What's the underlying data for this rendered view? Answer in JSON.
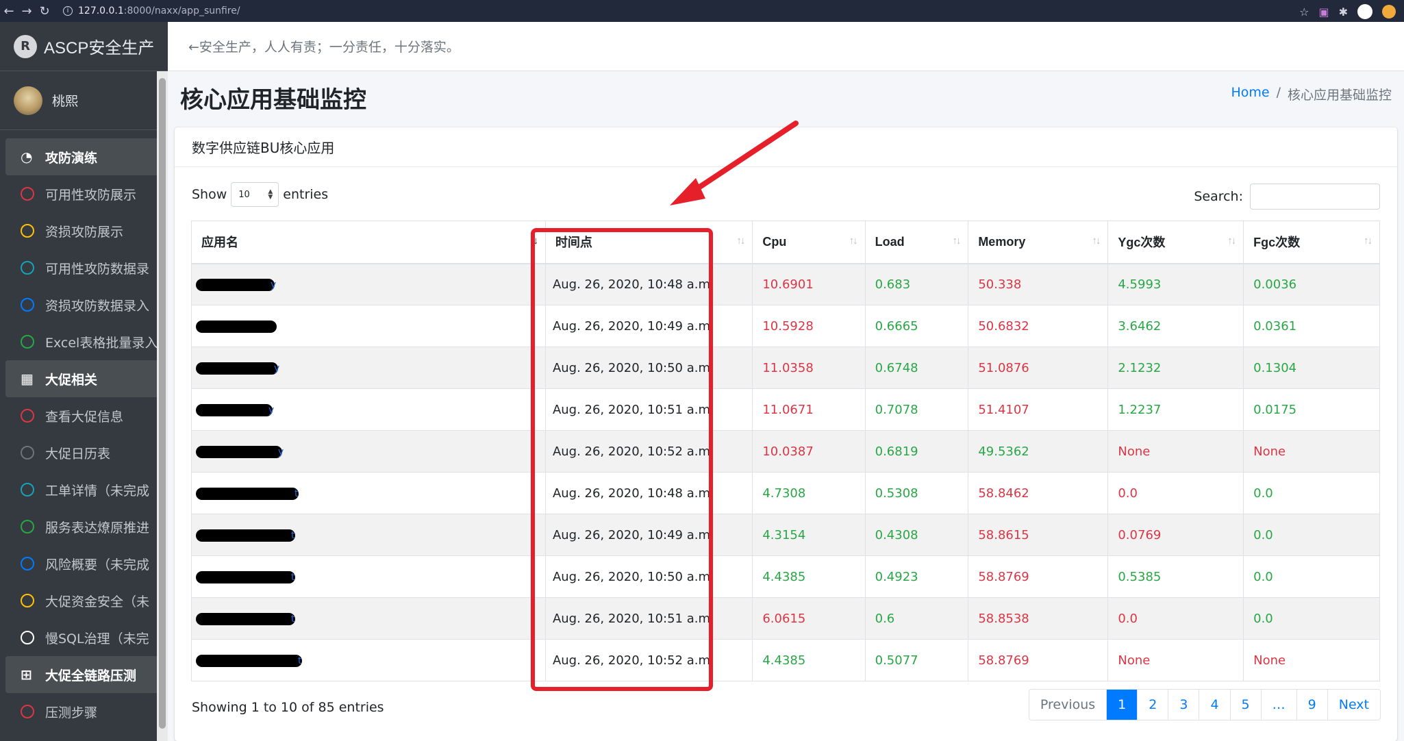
{
  "browser": {
    "url_host": "127.0.0.1",
    "url_path": ":8000/naxx/app_sunfire/"
  },
  "brand": {
    "name": "ASCP安全生产",
    "logo_letter": "R"
  },
  "user": {
    "name": "桃熙"
  },
  "sidebar": {
    "items": [
      {
        "label": "攻防演练",
        "type": "header",
        "icon": "dashboard-icon"
      },
      {
        "label": "可用性攻防展示",
        "type": "item",
        "color": "#dc3545"
      },
      {
        "label": "资损攻防展示",
        "type": "item",
        "color": "#ffc107"
      },
      {
        "label": "可用性攻防数据录",
        "type": "item",
        "color": "#17a2b8"
      },
      {
        "label": "资损攻防数据录入",
        "type": "item",
        "color": "#007bff"
      },
      {
        "label": "Excel表格批量录入",
        "type": "item",
        "color": "#28a745"
      },
      {
        "label": "大促相关",
        "type": "header",
        "icon": "grid-icon"
      },
      {
        "label": "查看大促信息",
        "type": "item",
        "color": "#dc3545"
      },
      {
        "label": "大促日历表",
        "type": "item",
        "color": "#6c757d"
      },
      {
        "label": "工单详情（未完成",
        "type": "item",
        "color": "#17a2b8"
      },
      {
        "label": "服务表达燎原推进",
        "type": "item",
        "color": "#28a745"
      },
      {
        "label": "风险概要（未完成",
        "type": "item",
        "color": "#007bff"
      },
      {
        "label": "大促资金安全（未",
        "type": "item",
        "color": "#ffc107"
      },
      {
        "label": "慢SQL治理（未完",
        "type": "item",
        "color": "#ffffff"
      },
      {
        "label": "大促全链路压测",
        "type": "header",
        "icon": "plus-square-icon"
      },
      {
        "label": "压测步骤",
        "type": "item",
        "color": "#dc3545"
      }
    ]
  },
  "topnav": {
    "slogan": "←安全生产，人人有责；一分责任，十分落实。"
  },
  "page": {
    "title": "核心应用基础监控"
  },
  "breadcrumb": {
    "home": "Home",
    "separator": "/",
    "current": "核心应用基础监控"
  },
  "card": {
    "title": "数字供应链BU核心应用"
  },
  "controls": {
    "show_label": "Show",
    "entries_value": "10",
    "entries_label": "entries",
    "search_label": "Search:"
  },
  "table": {
    "columns": [
      "应用名",
      "时间点",
      "Cpu",
      "Load",
      "Memory",
      "Ygc次数",
      "Fgc次数"
    ],
    "rows": [
      {
        "app_tail": "y",
        "time": "Aug. 26, 2020, 10:48 a.m.",
        "cpu": "10.6901",
        "load": "0.683",
        "memory": "50.338",
        "ygc": "4.5993",
        "fgc": "0.0036",
        "colors": [
          "red",
          "green",
          "red",
          "green",
          "green"
        ]
      },
      {
        "app_tail": "",
        "time": "Aug. 26, 2020, 10:49 a.m.",
        "cpu": "10.5928",
        "load": "0.6665",
        "memory": "50.6832",
        "ygc": "3.6462",
        "fgc": "0.0361",
        "colors": [
          "red",
          "green",
          "red",
          "green",
          "green"
        ]
      },
      {
        "app_tail": "y",
        "time": "Aug. 26, 2020, 10:50 a.m.",
        "cpu": "11.0358",
        "load": "0.6748",
        "memory": "51.0876",
        "ygc": "2.1232",
        "fgc": "0.1304",
        "colors": [
          "red",
          "green",
          "red",
          "green",
          "green"
        ]
      },
      {
        "app_tail": "y",
        "time": "Aug. 26, 2020, 10:51 a.m.",
        "cpu": "11.0671",
        "load": "0.7078",
        "memory": "51.4107",
        "ygc": "1.2237",
        "fgc": "0.0175",
        "colors": [
          "red",
          "green",
          "red",
          "green",
          "green"
        ]
      },
      {
        "app_tail": "y",
        "time": "Aug. 26, 2020, 10:52 a.m.",
        "cpu": "10.0387",
        "load": "0.6819",
        "memory": "49.5362",
        "ygc": "None",
        "fgc": "None",
        "colors": [
          "red",
          "green",
          "green",
          "red",
          "red"
        ]
      },
      {
        "app_tail": "t",
        "time": "Aug. 26, 2020, 10:48 a.m.",
        "cpu": "4.7308",
        "load": "0.5308",
        "memory": "58.8462",
        "ygc": "0.0",
        "fgc": "0.0",
        "colors": [
          "green",
          "green",
          "red",
          "red",
          "green"
        ]
      },
      {
        "app_tail": "t",
        "time": "Aug. 26, 2020, 10:49 a.m.",
        "cpu": "4.3154",
        "load": "0.4308",
        "memory": "58.8615",
        "ygc": "0.0769",
        "fgc": "0.0",
        "colors": [
          "green",
          "green",
          "red",
          "red",
          "green"
        ]
      },
      {
        "app_tail": "t",
        "time": "Aug. 26, 2020, 10:50 a.m.",
        "cpu": "4.4385",
        "load": "0.4923",
        "memory": "58.8769",
        "ygc": "0.5385",
        "fgc": "0.0",
        "colors": [
          "green",
          "green",
          "red",
          "green",
          "green"
        ]
      },
      {
        "app_tail": "t",
        "time": "Aug. 26, 2020, 10:51 a.m.",
        "cpu": "6.0615",
        "load": "0.6",
        "memory": "58.8538",
        "ygc": "0.0",
        "fgc": "0.0",
        "colors": [
          "red",
          "green",
          "red",
          "red",
          "green"
        ]
      },
      {
        "app_tail": "t",
        "time": "Aug. 26, 2020, 10:52 a.m.",
        "cpu": "4.4385",
        "load": "0.5077",
        "memory": "58.8769",
        "ygc": "None",
        "fgc": "None",
        "colors": [
          "green",
          "green",
          "red",
          "red",
          "red"
        ]
      }
    ]
  },
  "footer": {
    "info": "Showing 1 to 10 of 85 entries",
    "pages": [
      "Previous",
      "1",
      "2",
      "3",
      "4",
      "5",
      "…",
      "9",
      "Next"
    ],
    "active_page": "1"
  },
  "colors": {
    "red": "#dc3545",
    "green": "#28a745",
    "primary": "#007bff",
    "annotation": "#e5202b"
  }
}
